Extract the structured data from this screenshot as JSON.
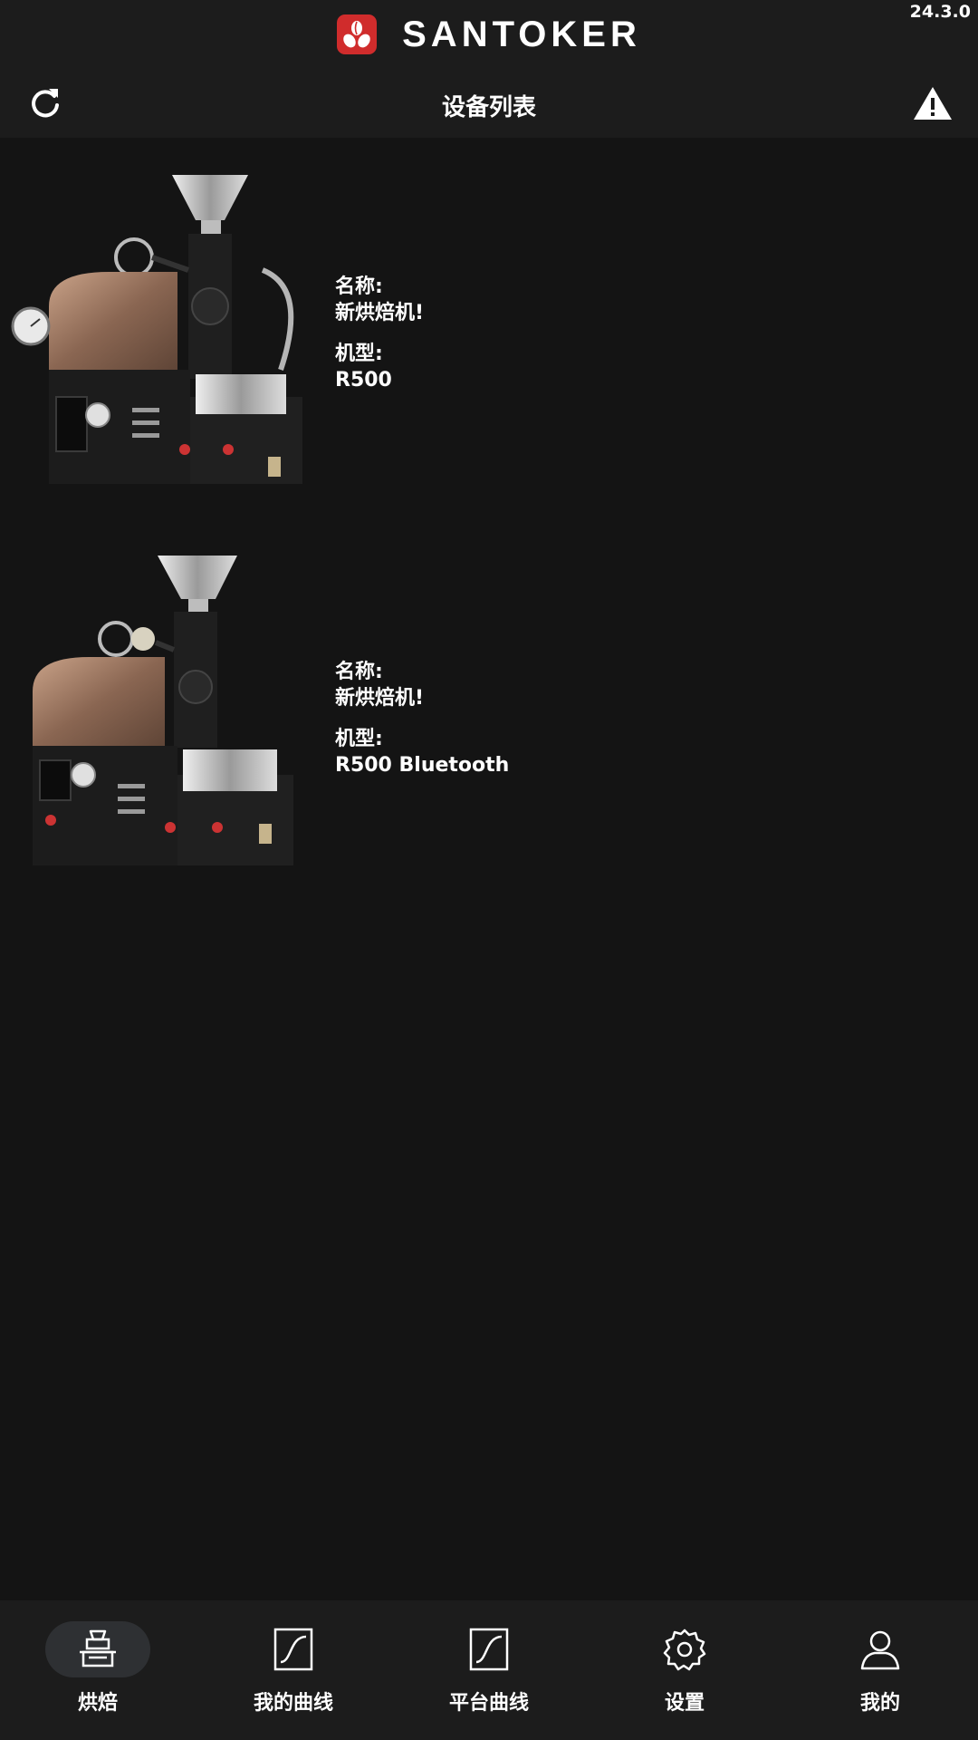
{
  "app": {
    "brand_name": "SANTOKER",
    "version": "24.3.0"
  },
  "header": {
    "title": "设备列表",
    "refresh_icon": "refresh-icon",
    "warning_icon": "warning-icon"
  },
  "devices": [
    {
      "name_label": "名称:",
      "name": "新烘焙机!",
      "model_label": "机型:",
      "model": "R500"
    },
    {
      "name_label": "名称:",
      "name": "新烘焙机!",
      "model_label": "机型:",
      "model": "R500 Bluetooth"
    }
  ],
  "bottom_nav": [
    {
      "label": "烘焙",
      "icon": "roaster-icon",
      "active": true
    },
    {
      "label": "我的曲线",
      "icon": "curve-icon",
      "active": false
    },
    {
      "label": "平台曲线",
      "icon": "curve-icon",
      "active": false
    },
    {
      "label": "设置",
      "icon": "gear-icon",
      "active": false
    },
    {
      "label": "我的",
      "icon": "user-icon",
      "active": false
    }
  ],
  "colors": {
    "background": "#141414",
    "bar": "#1c1c1c",
    "brand_red": "#d02c2c",
    "active_pill": "#2e3033"
  }
}
